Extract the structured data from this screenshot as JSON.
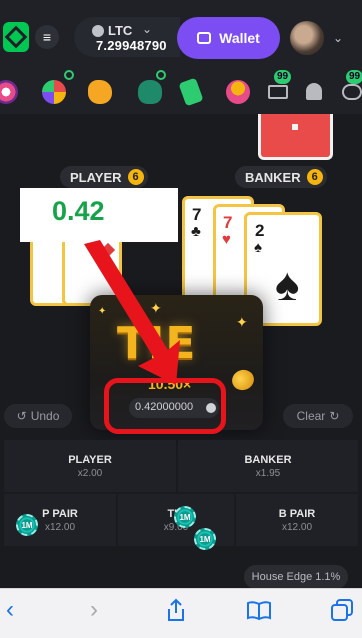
{
  "header": {
    "currency": "LTC",
    "balance": "7.29948790",
    "wallet_label": "Wallet"
  },
  "icon_strip": {
    "items": [
      "wheel-icon",
      "spin-wheel-icon",
      "piggy-bank-icon",
      "bug-icon",
      "cash-tag-icon",
      "trophy-icon",
      "mail-icon",
      "bell-icon",
      "chat-icon"
    ],
    "mail_badge": "99",
    "chat_badge": "99"
  },
  "table": {
    "player_label": "PLAYER",
    "player_score": "6",
    "banker_label": "BANKER",
    "banker_score": "6",
    "player_cards": [],
    "banker_cards": [
      {
        "rank": "7",
        "suit": "♣",
        "color": "black"
      },
      {
        "rank": "7",
        "suit": "♥",
        "color": "red"
      },
      {
        "rank": "2",
        "suit": "♠",
        "color": "black"
      }
    ]
  },
  "overlay_value": "0.42",
  "result": {
    "title": "TIE",
    "multiplier": "10.50×",
    "payout": "0.42000000"
  },
  "controls": {
    "undo_label": "Undo",
    "clear_label": "Clear"
  },
  "bets": [
    {
      "name": "PLAYER",
      "odds": "x2.00"
    },
    {
      "name": "BANKER",
      "odds": "x1.95"
    },
    {
      "name": "P PAIR",
      "odds": "x12.00",
      "chip": "1M"
    },
    {
      "name": "TIE",
      "odds": "x9.00",
      "chip": "1M"
    },
    {
      "name": "B PAIR",
      "odds": "x12.00"
    }
  ],
  "tie_chip2": "1M",
  "house_edge": "House Edge 1.1%"
}
